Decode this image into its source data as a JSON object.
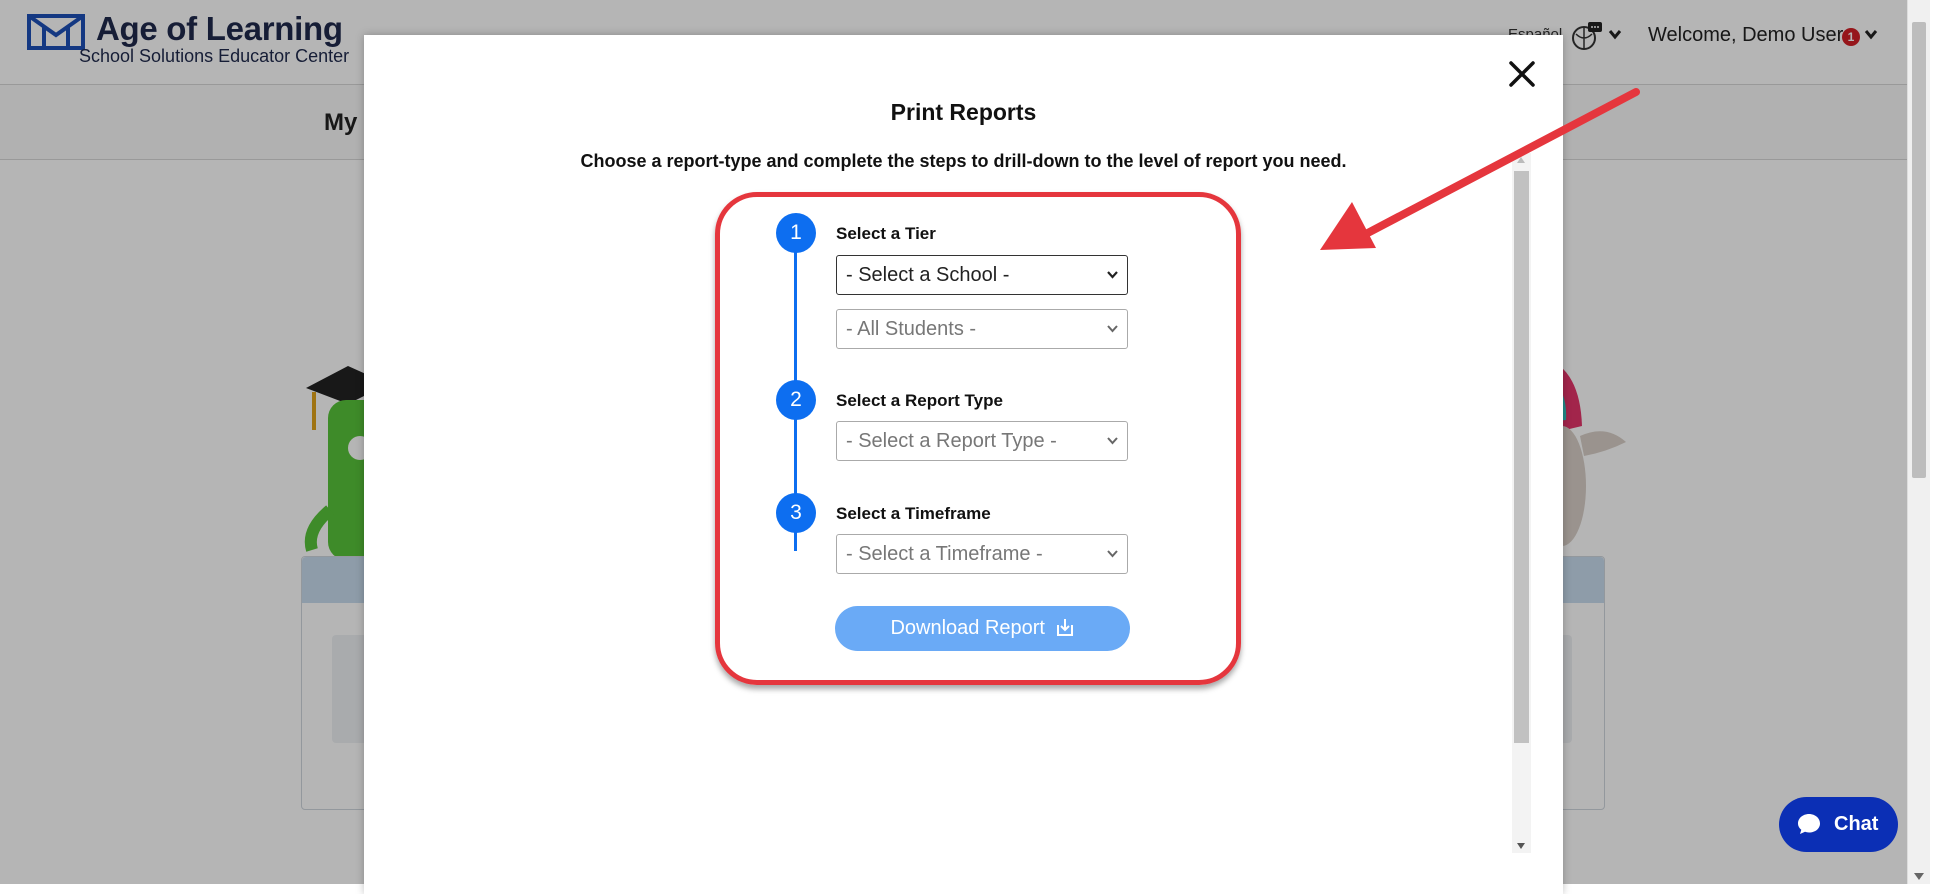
{
  "header": {
    "brand_title": "Age of Learning",
    "brand_subtitle": "School Solutions Educator Center",
    "language_link": "Español",
    "welcome_text": "Welcome, Demo User",
    "notification_count": "1"
  },
  "subnav": {
    "title": "My"
  },
  "modal": {
    "title": "Print Reports",
    "instructions": "Choose a report-type and complete the steps to drill-down to the level of report you need.",
    "steps": [
      {
        "number": "1",
        "label": "Select a Tier",
        "selects": [
          "- Select a School -",
          "- All Students -"
        ]
      },
      {
        "number": "2",
        "label": "Select a Report Type",
        "selects": [
          "- Select a Report Type -"
        ]
      },
      {
        "number": "3",
        "label": "Select a Timeframe",
        "selects": [
          "- Select a Timeframe -"
        ]
      }
    ],
    "download_label": "Download Report"
  },
  "chat": {
    "label": "Chat"
  },
  "colors": {
    "step_blue": "#0d6ef0",
    "download_blue": "#6aaaf6",
    "highlight_red": "#e5363d",
    "chat_navy": "#0b2fb5",
    "notification_red": "#d32027"
  },
  "icons": [
    "logo-icon",
    "language-chat-icon",
    "chevron-down-icon",
    "close-icon",
    "download-icon",
    "chat-bubble-icon"
  ]
}
